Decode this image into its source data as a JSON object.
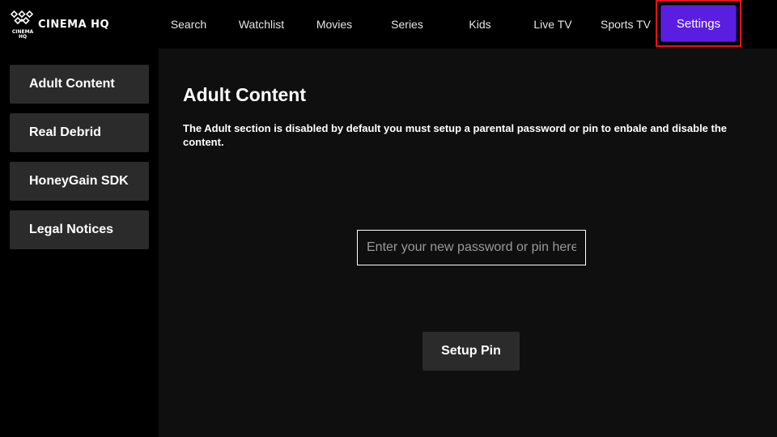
{
  "brand": {
    "name": "CINEMA HQ",
    "badge_line1": "CINEMA",
    "badge_line2": "HQ"
  },
  "nav": {
    "items": [
      "Search",
      "Watchlist",
      "Movies",
      "Series",
      "Kids",
      "Live TV",
      "Sports TV",
      "Settings"
    ],
    "selected": "Settings"
  },
  "sidebar": {
    "items": [
      "Adult Content",
      "Real Debrid",
      "HoneyGain SDK",
      "Legal Notices"
    ]
  },
  "main": {
    "title": "Adult Content",
    "description": "The Adult section is disabled by default you must setup a parental password or pin to enbale and disable the content.",
    "pin_input": {
      "value": "",
      "placeholder": "Enter your new password or pin here"
    },
    "setup_button": "Setup Pin"
  },
  "colors": {
    "accent": "#5a1ee0",
    "highlight_border": "#e3131d",
    "button_bg": "#2b2b2b"
  }
}
